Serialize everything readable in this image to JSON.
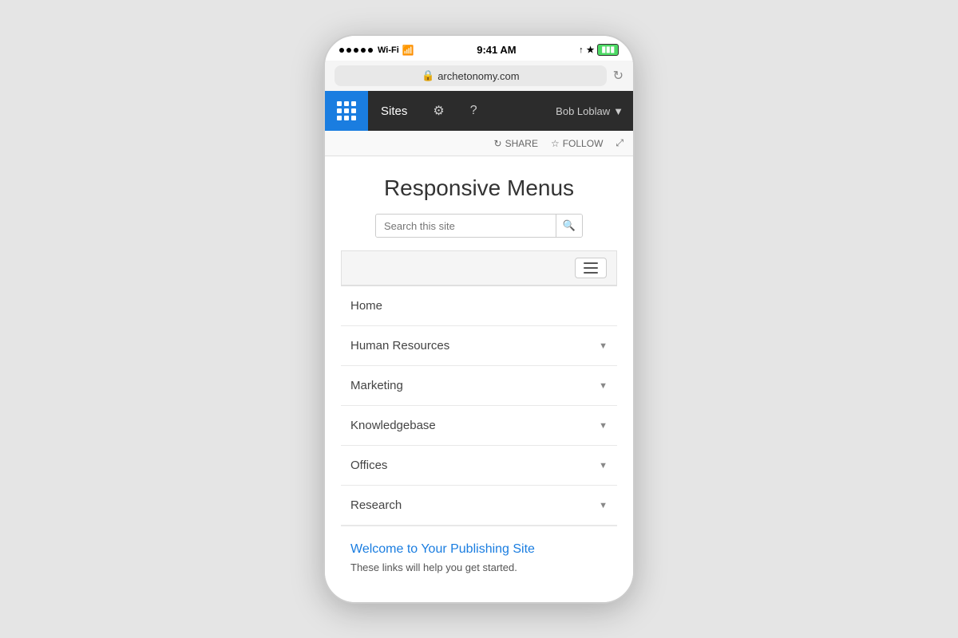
{
  "phone": {
    "status_bar": {
      "time": "9:41 AM",
      "carrier": "Wi-Fi",
      "dots": 5
    },
    "url_bar": {
      "lock_icon": "🔒",
      "url": "archetonomy.com"
    },
    "top_nav": {
      "grid_label": "grid",
      "sites_label": "Sites",
      "gear_icon": "⚙",
      "help_icon": "?",
      "user_name": "Bob Loblaw",
      "chevron": "▼"
    },
    "share_bar": {
      "share_label": "SHARE",
      "follow_label": "FOLLOW"
    },
    "content": {
      "page_title": "Responsive Menus",
      "search_placeholder": "Search this site",
      "menu_items": [
        {
          "label": "Home",
          "has_chevron": false
        },
        {
          "label": "Human Resources",
          "has_chevron": true
        },
        {
          "label": "Marketing",
          "has_chevron": true
        },
        {
          "label": "Knowledgebase",
          "has_chevron": true
        },
        {
          "label": "Offices",
          "has_chevron": true
        },
        {
          "label": "Research",
          "has_chevron": true
        }
      ],
      "welcome_title": "Welcome to Your Publishing Site",
      "welcome_text": "These links will help you get started."
    }
  }
}
